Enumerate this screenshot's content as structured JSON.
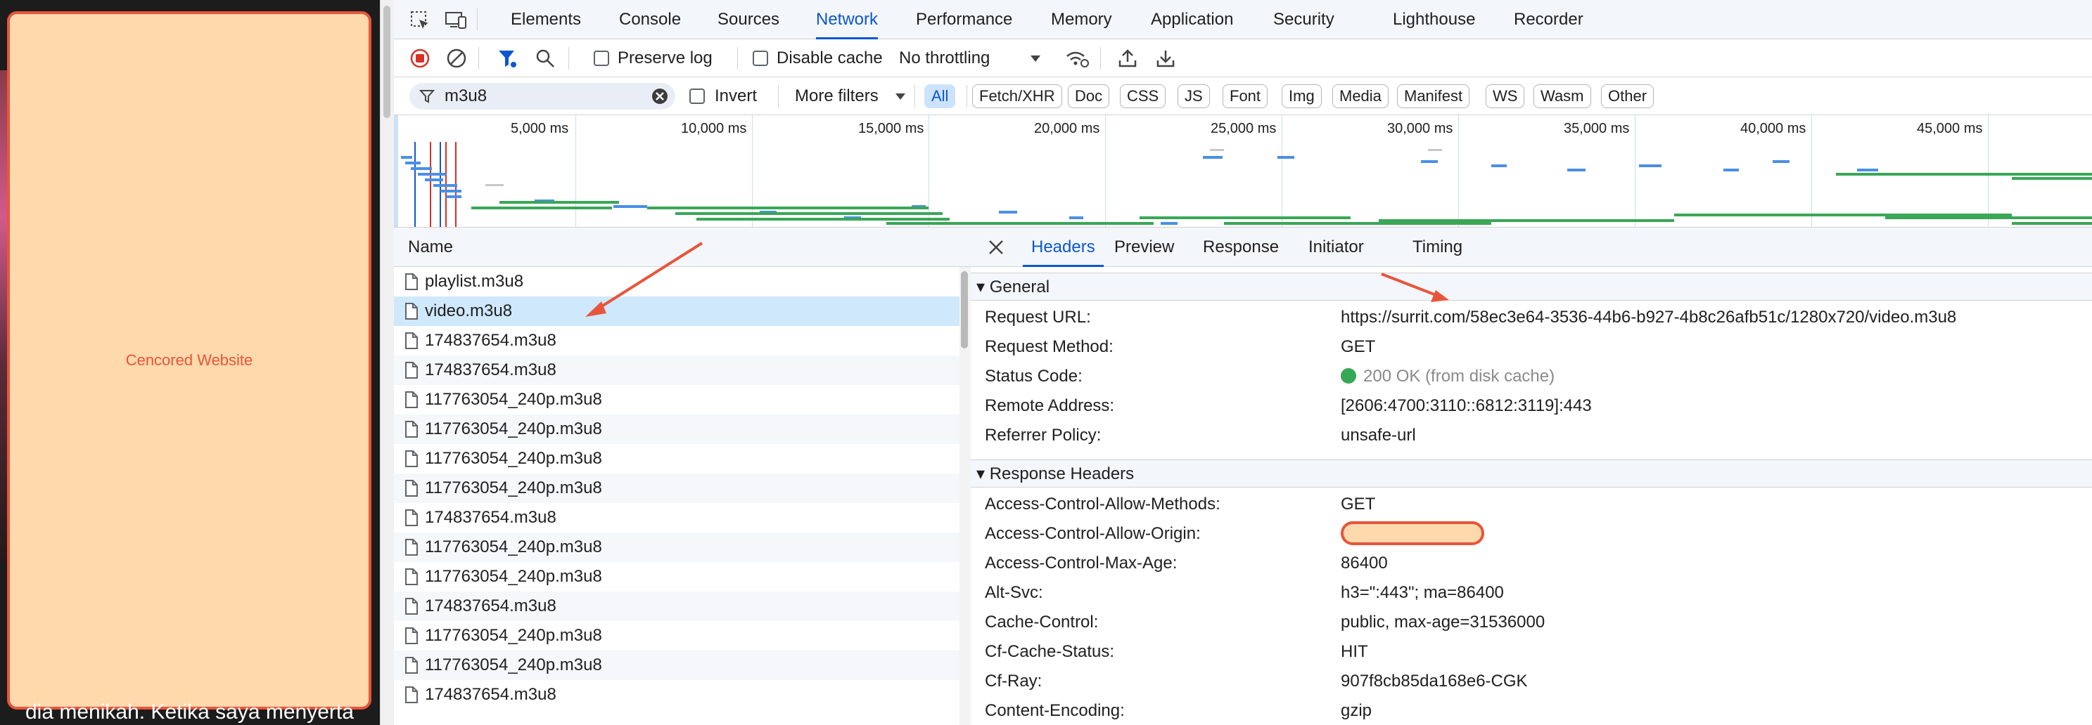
{
  "website": {
    "censor_label": "Cencored Website",
    "footer_text": "dia menikah. Ketika saya menyerta"
  },
  "devtools": {
    "tabs": [
      "Elements",
      "Console",
      "Sources",
      "Network",
      "Performance",
      "Memory",
      "Application",
      "Security",
      "Lighthouse",
      "Recorder"
    ],
    "active_tab": "Network",
    "toolbar": {
      "preserve_log": "Preserve log",
      "disable_cache": "Disable cache",
      "throttling": "No throttling"
    },
    "filter": {
      "value": "m3u8",
      "invert": "Invert",
      "more_filters": "More filters",
      "chips": [
        "All",
        "Fetch/XHR",
        "Doc",
        "CSS",
        "JS",
        "Font",
        "Img",
        "Media",
        "Manifest",
        "WS",
        "Wasm",
        "Other"
      ],
      "active_chip": "All"
    },
    "overview": {
      "ticks": [
        "5,000 ms",
        "10,000 ms",
        "15,000 ms",
        "20,000 ms",
        "25,000 ms",
        "30,000 ms",
        "35,000 ms",
        "40,000 ms",
        "45,000 ms"
      ]
    },
    "requests": {
      "header": "Name",
      "rows": [
        "playlist.m3u8",
        "video.m3u8",
        "174837654.m3u8",
        "174837654.m3u8",
        "117763054_240p.m3u8",
        "117763054_240p.m3u8",
        "117763054_240p.m3u8",
        "117763054_240p.m3u8",
        "174837654.m3u8",
        "117763054_240p.m3u8",
        "117763054_240p.m3u8",
        "174837654.m3u8",
        "117763054_240p.m3u8",
        "117763054_240p.m3u8",
        "174837654.m3u8"
      ],
      "selected_index": 1
    },
    "details": {
      "tabs": [
        "Headers",
        "Preview",
        "Response",
        "Initiator",
        "Timing"
      ],
      "active_tab": "Headers",
      "general_title": "General",
      "general": [
        {
          "name": "Request URL:",
          "value": "https://surrit.com/58ec3e64-3536-44b6-b927-4b8c26afb51c/1280x720/video.m3u8"
        },
        {
          "name": "Request Method:",
          "value": "GET"
        },
        {
          "name": "Status Code:",
          "value": "200 OK (from disk cache)"
        },
        {
          "name": "Remote Address:",
          "value": "[2606:4700:3110::6812:3119]:443"
        },
        {
          "name": "Referrer Policy:",
          "value": "unsafe-url"
        }
      ],
      "response_title": "Response Headers",
      "response": [
        {
          "name": "Access-Control-Allow-Methods:",
          "value": "GET"
        },
        {
          "name": "Access-Control-Allow-Origin:",
          "value": ""
        },
        {
          "name": "Access-Control-Max-Age:",
          "value": "86400"
        },
        {
          "name": "Alt-Svc:",
          "value": "h3=\":443\"; ma=86400"
        },
        {
          "name": "Cache-Control:",
          "value": "public, max-age=31536000"
        },
        {
          "name": "Cf-Cache-Status:",
          "value": "HIT"
        },
        {
          "name": "Cf-Ray:",
          "value": "907f8cb85da168e6-CGK"
        },
        {
          "name": "Content-Encoding:",
          "value": "gzip"
        }
      ]
    }
  },
  "colors": {
    "accent": "#0b57d0",
    "annotation": "#e8553a",
    "censor_fill": "#fdd9ac",
    "status_green": "#34a853"
  }
}
